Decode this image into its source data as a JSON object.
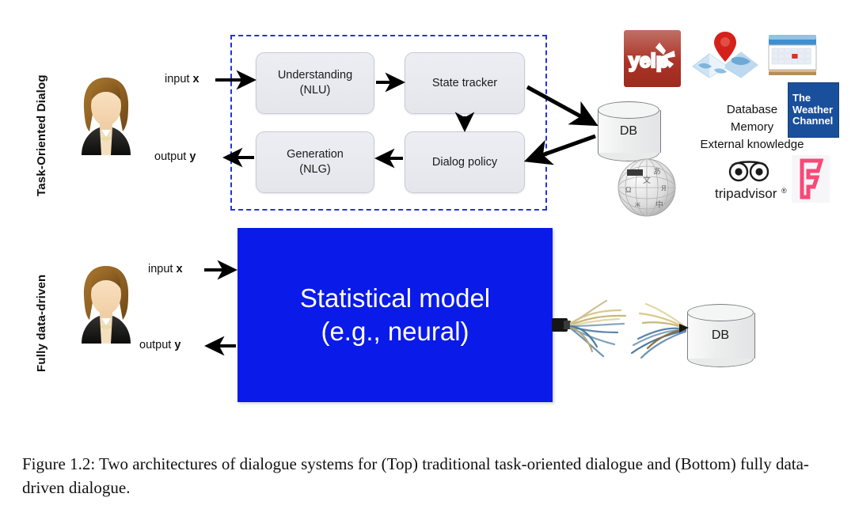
{
  "figure": {
    "caption": "Figure 1.2: Two architectures of dialogue systems for (Top) traditional task-oriented dialogue and (Bottom) fully data-driven dialogue."
  },
  "rows": {
    "top": {
      "side_label": "Task-Oriented Dialog",
      "input_label": "input",
      "input_var": "x",
      "output_label": "output",
      "output_var": "y",
      "modules": [
        {
          "id": "nlu",
          "line1": "Understanding",
          "line2": "(NLU)"
        },
        {
          "id": "state",
          "line1": "State tracker",
          "line2": ""
        },
        {
          "id": "nlg",
          "line1": "Generation",
          "line2": "(NLG)"
        },
        {
          "id": "policy",
          "line1": "Dialog policy",
          "line2": ""
        }
      ],
      "db_label": "DB",
      "knowledge_lines": [
        "Database",
        "Memory",
        "External knowledge"
      ],
      "logos": [
        {
          "name": "yelp-logo",
          "text": "yelp"
        },
        {
          "name": "map-logo",
          "text": ""
        },
        {
          "name": "calendar-logo",
          "text": ""
        },
        {
          "name": "weather-channel-logo",
          "line1": "The",
          "line2": "Weather",
          "line3": "Channel"
        },
        {
          "name": "wikipedia-logo",
          "text": ""
        },
        {
          "name": "tripadvisor-logo",
          "text": "tripadvisor"
        },
        {
          "name": "foursquare-logo",
          "text": ""
        }
      ]
    },
    "bottom": {
      "side_label": "Fully data-driven",
      "input_label": "input",
      "input_var": "x",
      "output_label": "output",
      "output_var": "y",
      "model_line1": "Statistical model",
      "model_line2": "(e.g., neural)",
      "db_label": "DB"
    }
  },
  "colors": {
    "dashed_border": "#2233dd",
    "model_box": "#0a1ae8",
    "module_box": "#e8eaef",
    "yelp_red": "#ab3327",
    "weather_blue": "#1a4f9c",
    "foursquare_pink": "#f94877",
    "map_pin_red": "#d4211a"
  }
}
